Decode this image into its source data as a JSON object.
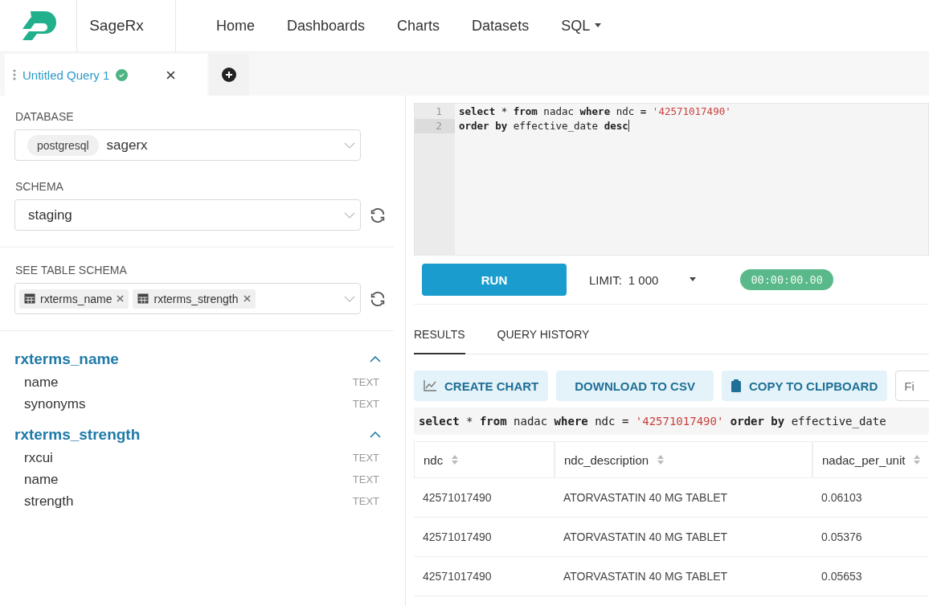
{
  "brand": {
    "name": "SageRx"
  },
  "nav": [
    {
      "label": "Home",
      "dropdown": false
    },
    {
      "label": "Dashboards",
      "dropdown": false
    },
    {
      "label": "Charts",
      "dropdown": false
    },
    {
      "label": "Datasets",
      "dropdown": false
    },
    {
      "label": "SQL",
      "dropdown": true
    }
  ],
  "query_tabs": [
    {
      "label": "Untitled Query 1",
      "selected": true,
      "saved": true
    }
  ],
  "database": {
    "label": "DATABASE",
    "backend": "postgresql",
    "value": "sagerx"
  },
  "schema": {
    "label": "SCHEMA",
    "value": "staging"
  },
  "table_schema": {
    "label": "SEE TABLE SCHEMA",
    "tags": [
      "rxterms_name",
      "rxterms_strength"
    ]
  },
  "tables": [
    {
      "name": "rxterms_name",
      "expanded": true,
      "columns": [
        {
          "name": "name",
          "type": "TEXT"
        },
        {
          "name": "synonyms",
          "type": "TEXT"
        }
      ]
    },
    {
      "name": "rxterms_strength",
      "expanded": true,
      "columns": [
        {
          "name": "rxcui",
          "type": "TEXT"
        },
        {
          "name": "name",
          "type": "TEXT"
        },
        {
          "name": "strength",
          "type": "TEXT"
        }
      ]
    }
  ],
  "editor": {
    "lines": [
      {
        "number": "1",
        "active": false,
        "tokens": [
          {
            "kind": "keyword",
            "text": "select"
          },
          {
            "kind": "plain",
            "text": " * "
          },
          {
            "kind": "keyword",
            "text": "from"
          },
          {
            "kind": "plain",
            "text": " nadac "
          },
          {
            "kind": "keyword",
            "text": "where"
          },
          {
            "kind": "plain",
            "text": " ndc "
          },
          {
            "kind": "keyword",
            "text": "="
          },
          {
            "kind": "string",
            "text": " '42571017490'"
          }
        ]
      },
      {
        "number": "2",
        "active": true,
        "tokens": [
          {
            "kind": "keyword",
            "text": "order"
          },
          {
            "kind": "keyword",
            "text": " by"
          },
          {
            "kind": "plain",
            "text": " effective_date "
          },
          {
            "kind": "keyword",
            "text": "desc"
          }
        ]
      }
    ]
  },
  "run_button": "RUN",
  "limit": {
    "label": "LIMIT:",
    "value": "1 000"
  },
  "timer": "00:00:00.00",
  "result_tabs": [
    {
      "label": "RESULTS",
      "selected": true
    },
    {
      "label": "QUERY HISTORY",
      "selected": false
    }
  ],
  "actions": [
    "CREATE CHART",
    "DOWNLOAD TO CSV",
    "COPY TO CLIPBOARD"
  ],
  "filter": {
    "placeholder": "Fi"
  },
  "executed_sql": [
    {
      "kind": "keyword",
      "text": "select"
    },
    {
      "kind": "plain",
      "text": " * "
    },
    {
      "kind": "keyword",
      "text": "from"
    },
    {
      "kind": "plain",
      "text": " nadac "
    },
    {
      "kind": "keyword",
      "text": "where"
    },
    {
      "kind": "plain",
      "text": " ndc = "
    },
    {
      "kind": "string",
      "text": "'42571017490'"
    },
    {
      "kind": "keyword",
      "text": " order by"
    },
    {
      "kind": "plain",
      "text": " effective_date"
    }
  ],
  "table": {
    "columns": [
      "ndc",
      "ndc_description",
      "nadac_per_unit"
    ],
    "rows": [
      [
        "42571017490",
        "ATORVASTATIN 40 MG TABLET",
        "0.06103"
      ],
      [
        "42571017490",
        "ATORVASTATIN 40 MG TABLET",
        "0.05376"
      ],
      [
        "42571017490",
        "ATORVASTATIN 40 MG TABLET",
        "0.05653"
      ]
    ]
  }
}
